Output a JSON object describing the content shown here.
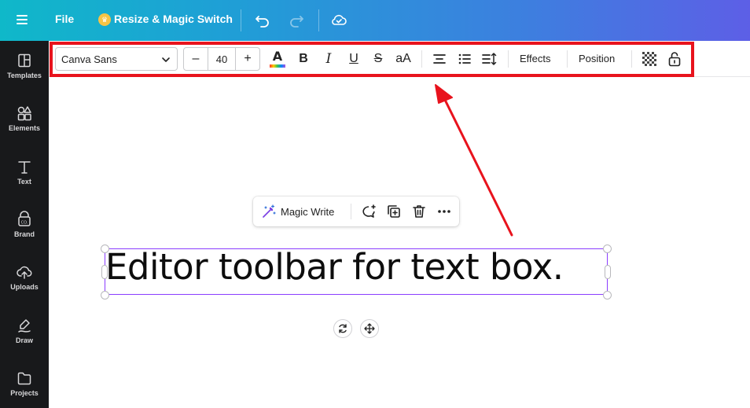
{
  "topbar": {
    "file_label": "File",
    "resize_label": "Resize & Magic Switch",
    "icons": [
      "menu-icon",
      "crown-icon",
      "undo-icon",
      "redo-icon",
      "cloud-sync-icon"
    ]
  },
  "sidebar": {
    "items": [
      {
        "label": "Templates",
        "icon": "templates-icon"
      },
      {
        "label": "Elements",
        "icon": "elements-icon"
      },
      {
        "label": "Text",
        "icon": "text-icon"
      },
      {
        "label": "Brand",
        "icon": "brand-icon"
      },
      {
        "label": "Uploads",
        "icon": "uploads-icon"
      },
      {
        "label": "Draw",
        "icon": "draw-icon"
      },
      {
        "label": "Projects",
        "icon": "projects-icon"
      }
    ]
  },
  "toolbar": {
    "font_family": "Canva Sans",
    "decrease_label": "–",
    "font_size": "40",
    "increase_label": "+",
    "color_letter": "A",
    "bold_label": "B",
    "italic_label": "I",
    "underline_label": "U",
    "strikethrough_label": "S",
    "case_label": "aA",
    "effects_label": "Effects",
    "position_label": "Position",
    "highlight_color": "#e8131d"
  },
  "canvas": {
    "text": "Editor toolbar for text box.",
    "magic_write_label": "Magic Write",
    "selection_color": "#8b3dff",
    "arrow_color": "#e8131d"
  },
  "colors": {
    "topbar_gradient_start": "#0fb8c9",
    "topbar_gradient_end": "#5d5fe6",
    "sidebar_bg": "#18191b"
  }
}
